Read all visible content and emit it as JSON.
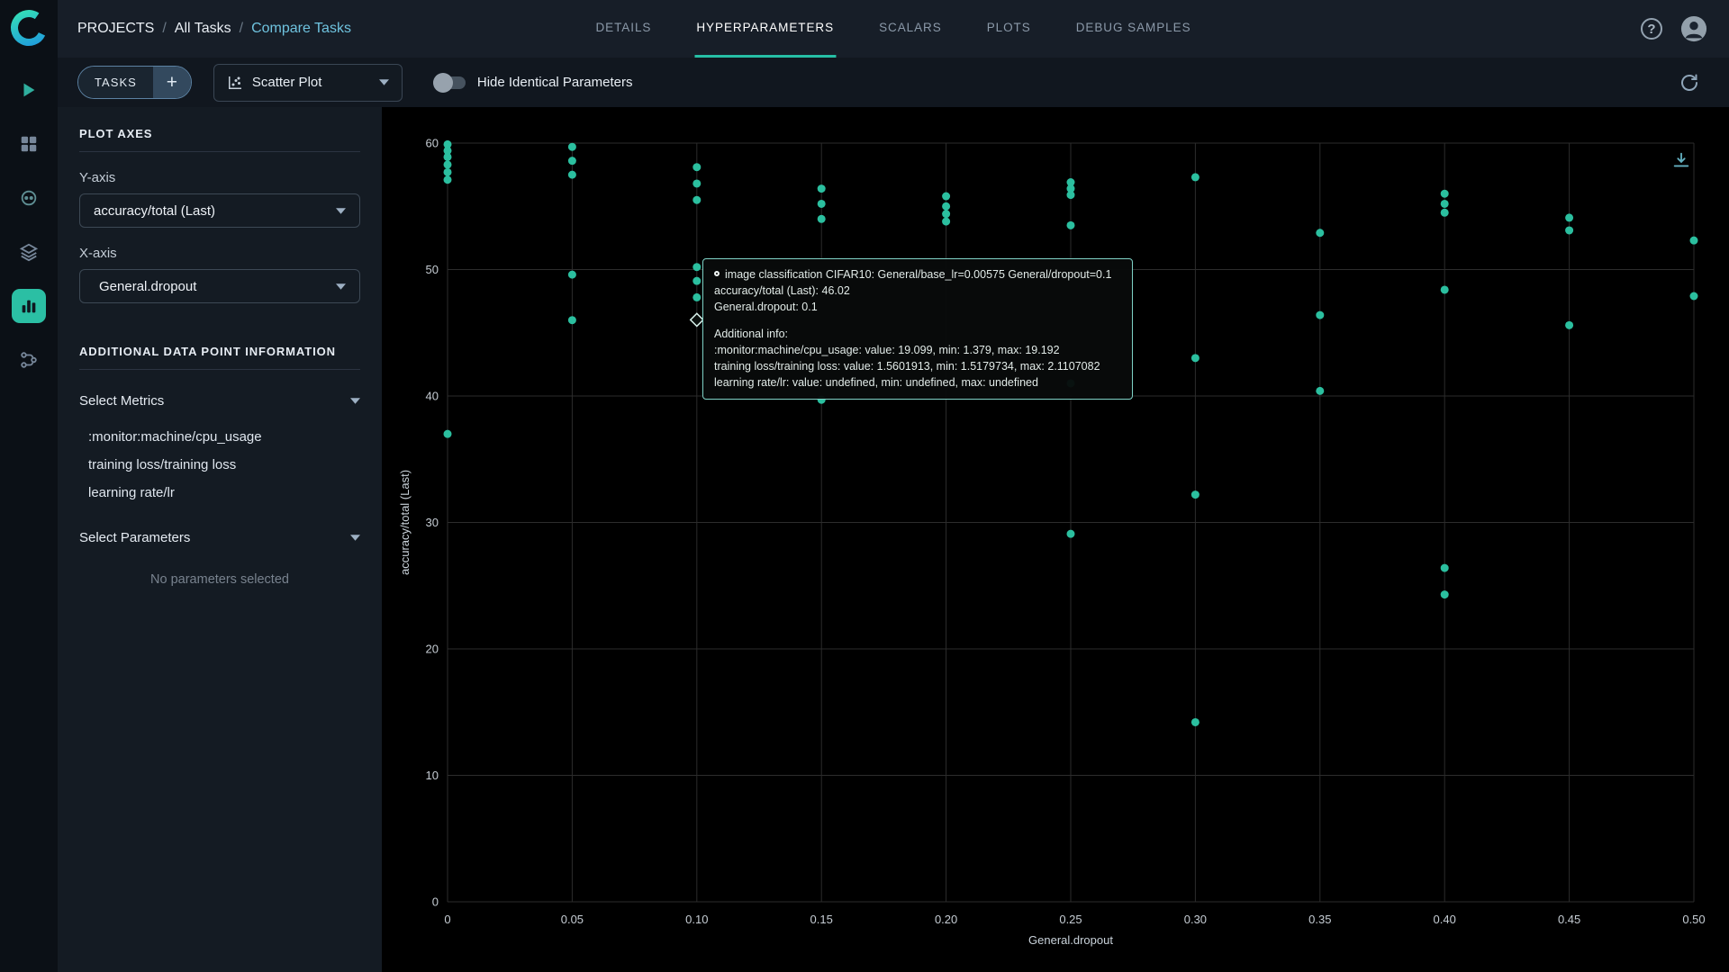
{
  "colors": {
    "accent": "#26bfa5",
    "point_color": "#2bbf9f",
    "tooltip_border": "#7fd2c6"
  },
  "header": {
    "breadcrumb": {
      "projects": "PROJECTS",
      "separator": "/",
      "all_tasks": "All Tasks",
      "compare_tasks": "Compare Tasks"
    },
    "tabs": [
      {
        "label": "DETAILS",
        "active": false
      },
      {
        "label": "HYPERPARAMETERS",
        "active": true
      },
      {
        "label": "SCALARS",
        "active": false
      },
      {
        "label": "PLOTS",
        "active": false
      },
      {
        "label": "DEBUG SAMPLES",
        "active": false
      }
    ],
    "help_glyph": "?"
  },
  "toolbar": {
    "tasks_button": "TASKS",
    "add_button": "+",
    "plot_type_value": "Scatter Plot",
    "hide_identical_label": "Hide Identical Parameters",
    "toggle_on": false
  },
  "sidebar_panel": {
    "plot_axes_title": "PLOT AXES",
    "y_axis_label": "Y-axis",
    "y_axis_value": "accuracy/total (Last)",
    "x_axis_label": "X-axis",
    "x_axis_value": "General.dropout",
    "additional_info_title": "ADDITIONAL DATA POINT INFORMATION",
    "select_metrics_label": "Select Metrics",
    "metrics": [
      ":monitor:machine/cpu_usage",
      "training loss/training loss",
      "learning rate/lr"
    ],
    "select_parameters_label": "Select Parameters",
    "no_parameters_text": "No parameters selected"
  },
  "tooltip": {
    "title": "image classification CIFAR10: General/base_lr=0.00575 General/dropout=0.1",
    "metric_line": "accuracy/total (Last): 46.02",
    "param_line": "General.dropout: 0.1",
    "additional_title": "Additional info:",
    "additional_lines": [
      ":monitor:machine/cpu_usage: value: 19.099, min: 1.379, max: 19.192",
      "training loss/training loss: value: 1.5601913, min: 1.5179734, max: 2.1107082",
      "learning rate/lr: value: undefined, min: undefined, max: undefined"
    ]
  },
  "chart_data": {
    "type": "scatter",
    "title": "",
    "xlabel": "General.dropout",
    "ylabel": "accuracy/total (Last)",
    "xlim": [
      0,
      0.5
    ],
    "ylim": [
      0,
      60
    ],
    "grid": true,
    "legend": false,
    "point_color": "#2bbf9f",
    "xticks": {
      "values": [
        0,
        0.05,
        0.1,
        0.15,
        0.2,
        0.25,
        0.3,
        0.35,
        0.4,
        0.45,
        0.5
      ],
      "labels": [
        "0",
        "0.05",
        "0.10",
        "0.15",
        "0.20",
        "0.25",
        "0.30",
        "0.35",
        "0.40",
        "0.45",
        "0.50"
      ]
    },
    "yticks": {
      "values": [
        0,
        10,
        20,
        30,
        40,
        50,
        60
      ],
      "labels": [
        "0",
        "10",
        "20",
        "30",
        "40",
        "50",
        "60"
      ]
    },
    "points": [
      [
        0,
        59.9
      ],
      [
        0,
        59.4
      ],
      [
        0,
        58.9
      ],
      [
        0,
        58.3
      ],
      [
        0,
        57.7
      ],
      [
        0,
        57.1
      ],
      [
        0,
        37.0
      ],
      [
        0.05,
        59.7
      ],
      [
        0.05,
        58.6
      ],
      [
        0.05,
        57.5
      ],
      [
        0.05,
        49.6
      ],
      [
        0.05,
        46.0
      ],
      [
        0.1,
        58.1
      ],
      [
        0.1,
        56.8
      ],
      [
        0.1,
        55.5
      ],
      [
        0.1,
        50.2
      ],
      [
        0.1,
        49.1
      ],
      [
        0.1,
        47.8
      ],
      [
        0.1,
        46.02
      ],
      [
        0.15,
        56.4
      ],
      [
        0.15,
        55.2
      ],
      [
        0.15,
        54.0
      ],
      [
        0.15,
        39.7
      ],
      [
        0.2,
        55.8
      ],
      [
        0.2,
        55.0
      ],
      [
        0.2,
        54.4
      ],
      [
        0.2,
        53.8
      ],
      [
        0.25,
        56.9
      ],
      [
        0.25,
        56.4
      ],
      [
        0.25,
        55.9
      ],
      [
        0.25,
        53.5
      ],
      [
        0.25,
        41.0
      ],
      [
        0.25,
        29.1
      ],
      [
        0.3,
        57.3
      ],
      [
        0.3,
        43.0
      ],
      [
        0.3,
        32.2
      ],
      [
        0.3,
        14.2
      ],
      [
        0.35,
        52.9
      ],
      [
        0.35,
        46.4
      ],
      [
        0.35,
        40.4
      ],
      [
        0.4,
        56.0
      ],
      [
        0.4,
        55.2
      ],
      [
        0.4,
        54.5
      ],
      [
        0.4,
        48.4
      ],
      [
        0.4,
        26.4
      ],
      [
        0.4,
        24.3
      ],
      [
        0.45,
        54.1
      ],
      [
        0.45,
        53.1
      ],
      [
        0.45,
        45.6
      ],
      [
        0.5,
        52.3
      ],
      [
        0.5,
        47.9
      ]
    ],
    "hover_point": {
      "x": 0.1,
      "y": 46.02
    }
  }
}
